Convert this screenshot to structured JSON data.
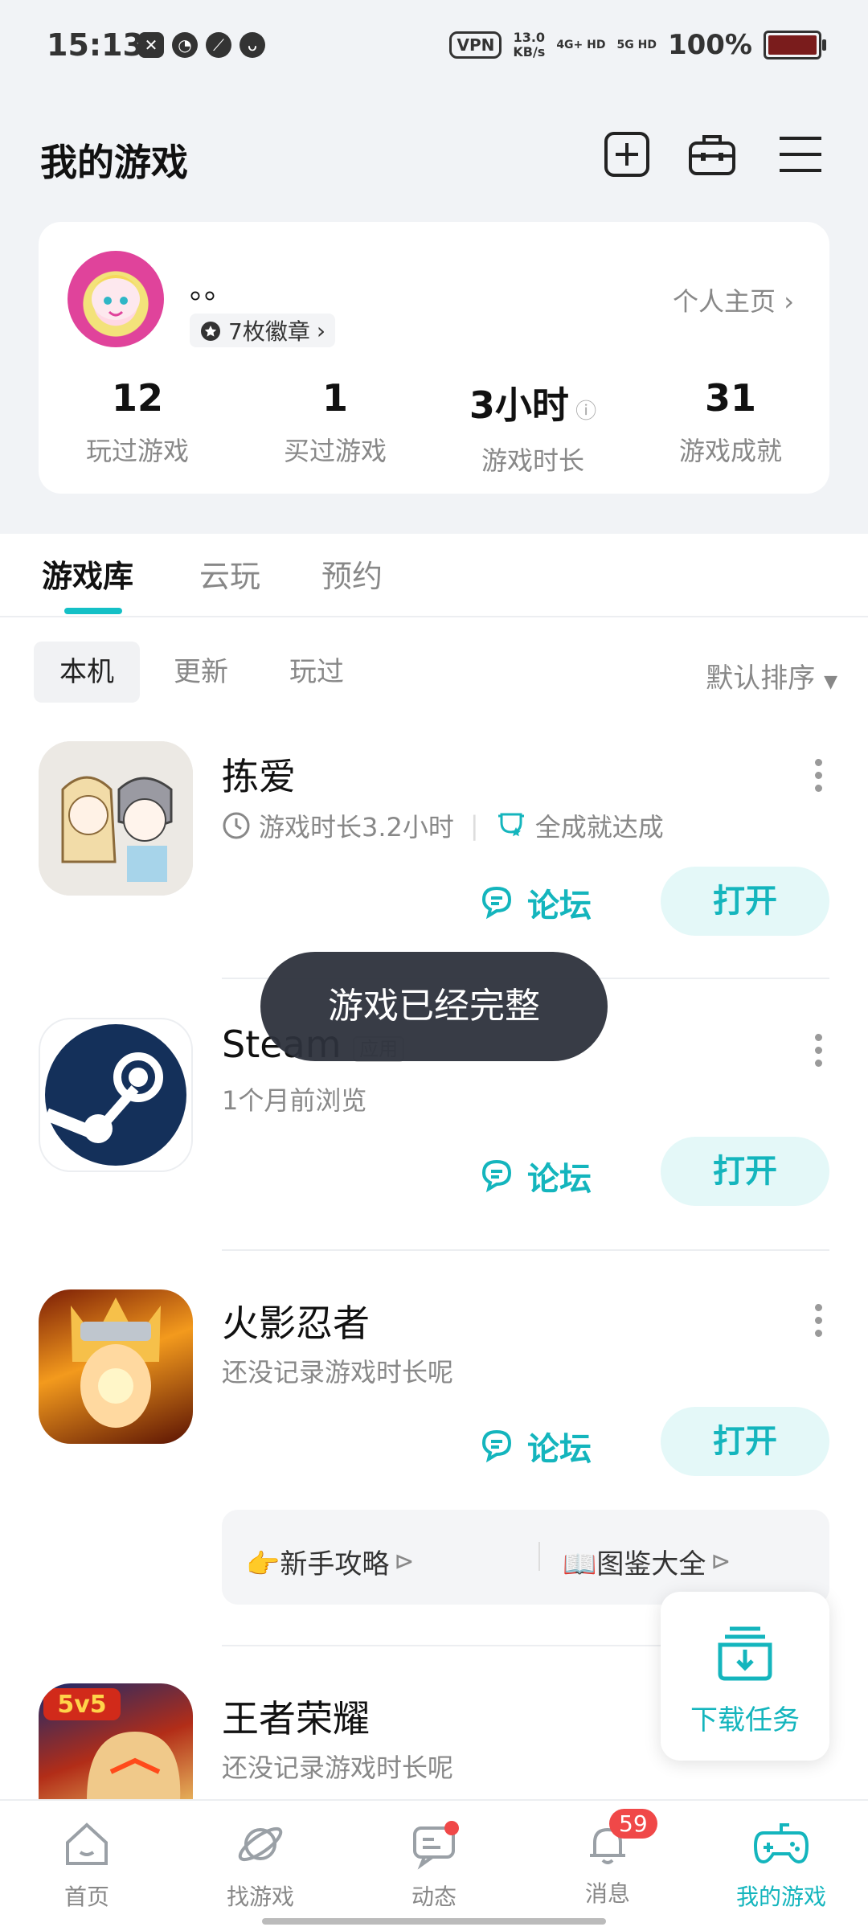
{
  "status_bar": {
    "time": "15:13",
    "vpn": "VPN",
    "speed_value": "13.0",
    "speed_unit": "KB/s",
    "net1": "4G+ HD",
    "net2": "5G HD",
    "battery": "100%"
  },
  "header": {
    "title": "我的游戏"
  },
  "profile": {
    "nickname": "。。",
    "badges": "7枚徽章",
    "profile_link": "个人主页",
    "stats": [
      {
        "value": "12",
        "label": "玩过游戏"
      },
      {
        "value": "1",
        "label": "买过游戏"
      },
      {
        "value": "3小时",
        "label": "游戏时长"
      },
      {
        "value": "31",
        "label": "游戏成就"
      }
    ]
  },
  "tabs": [
    "游戏库",
    "云玩",
    "预约"
  ],
  "filters": [
    "本机",
    "更新",
    "玩过"
  ],
  "sort_label": "默认排序",
  "games": [
    {
      "name": "拣爱",
      "sub": "游戏时长3.2小时",
      "achievement": "全成就达成",
      "forum": "论坛",
      "open": "打开"
    },
    {
      "name": "Steam",
      "tag": "应用",
      "sub": "1个月前浏览",
      "forum": "论坛",
      "open": "打开"
    },
    {
      "name": "火影忍者",
      "sub": "还没记录游戏时长呢",
      "forum": "论坛",
      "open": "打开"
    },
    {
      "name": "王者荣耀",
      "sub": "还没记录游戏时长呢"
    }
  ],
  "guides": [
    "👉新手攻略",
    "📖图鉴大全"
  ],
  "toast": "游戏已经完整",
  "download_task": "下载任务",
  "bottom_nav": [
    {
      "label": "首页"
    },
    {
      "label": "找游戏"
    },
    {
      "label": "动态"
    },
    {
      "label": "消息",
      "badge": "59"
    },
    {
      "label": "我的游戏"
    }
  ],
  "colors": {
    "accent": "#14b5bd",
    "toast_bg": "#2d323c",
    "badge": "#f04848"
  }
}
